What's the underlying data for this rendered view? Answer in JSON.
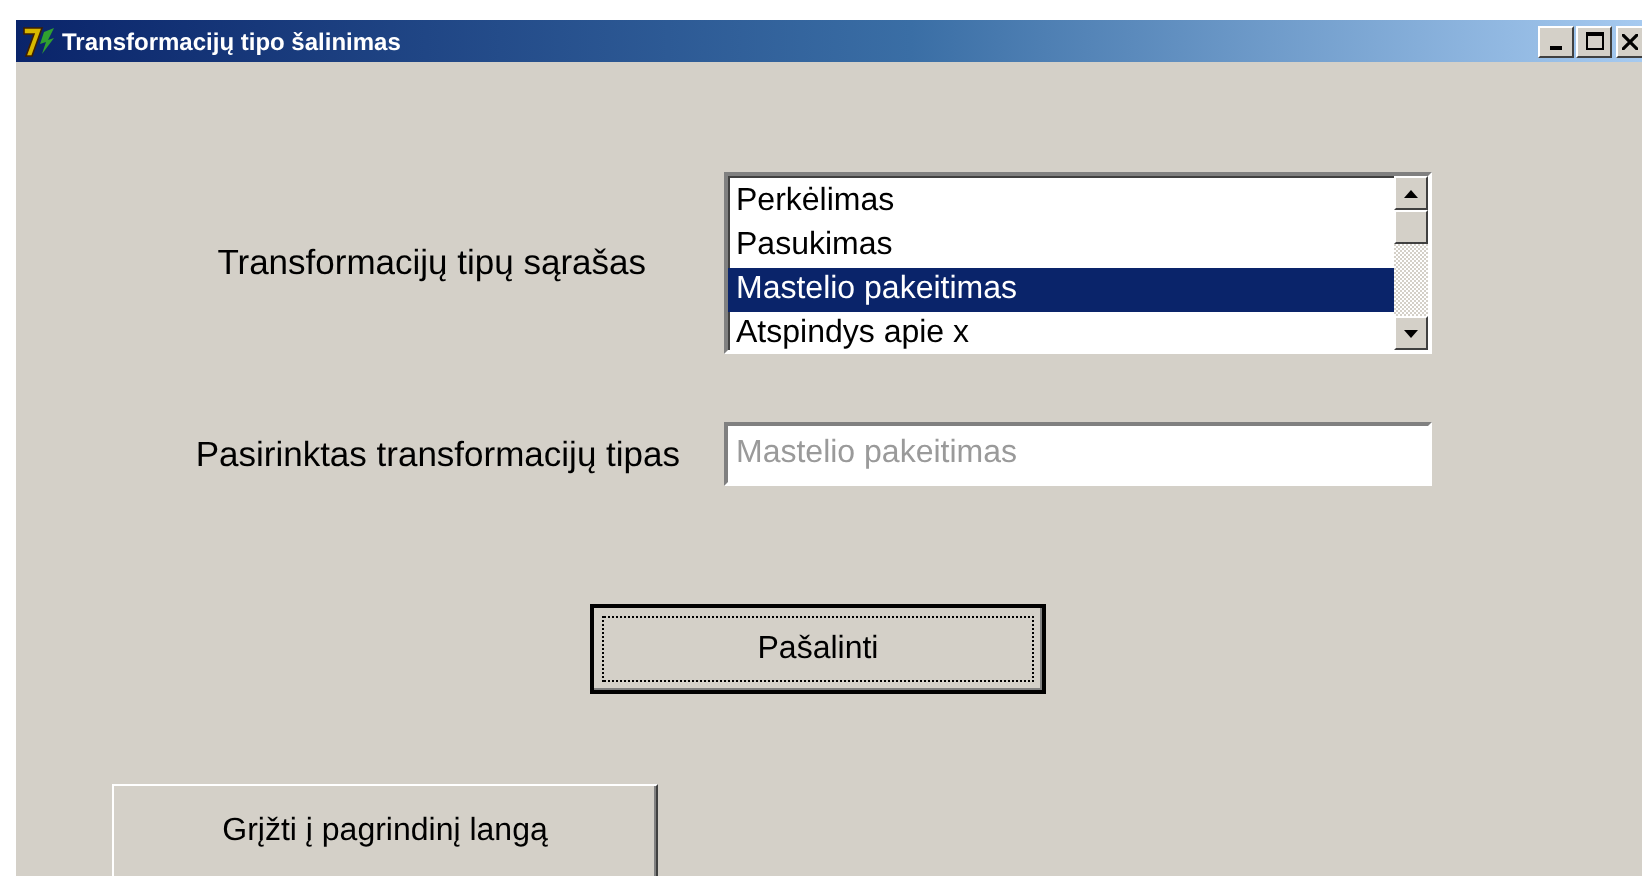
{
  "window": {
    "title": "Transformacijų tipo šalinimas"
  },
  "list_label": "Transformacijų tipų sąrašas",
  "list_items": [
    {
      "label": "Perkėlimas",
      "selected": false
    },
    {
      "label": "Pasukimas",
      "selected": false
    },
    {
      "label": "Mastelio pakeitimas",
      "selected": true
    },
    {
      "label": "Atspindys apie x",
      "selected": false
    }
  ],
  "selected_label": "Pasirinktas transformacijų tipas",
  "selected_field": {
    "value": "Mastelio pakeitimas",
    "disabled": true
  },
  "buttons": [
    {
      "label": "Pašalinti",
      "focused": true
    },
    {
      "label": "Grįžti į pagrindinį langą",
      "focused": false
    }
  ]
}
